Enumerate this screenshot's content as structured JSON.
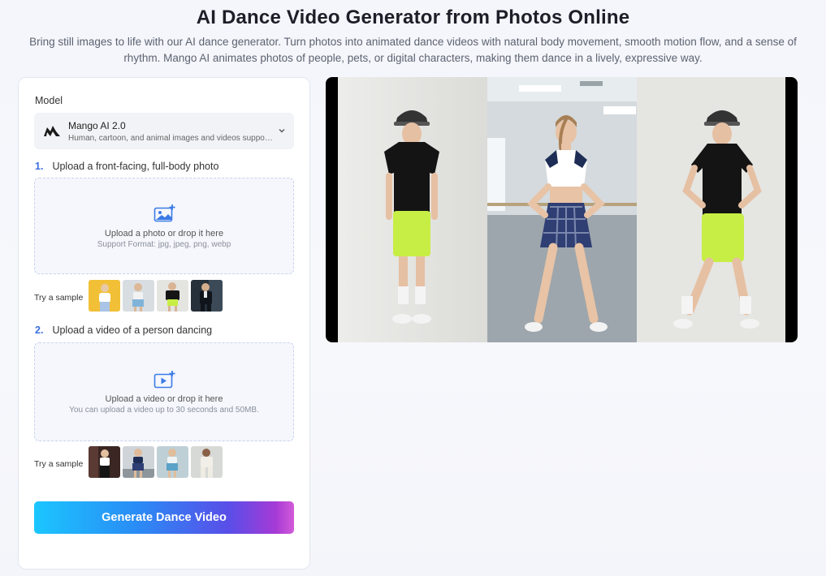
{
  "hero": {
    "title": "AI Dance Video Generator from Photos Online",
    "subtitle": "Bring still images to life with our AI dance generator. Turn photos into animated dance videos with natural body movement, smooth motion flow, and a sense of rhythm. Mango AI animates photos of people, pets, or digital characters, making them dance in a lively, expressive way."
  },
  "panel": {
    "model_label": "Model",
    "model": {
      "name": "Mango AI 2.0",
      "description": "Human, cartoon, and animal images and videos supported",
      "icon": "mango-logo-icon"
    },
    "step1": {
      "number": "1.",
      "label": "Upload a front-facing, full-body photo",
      "drop_title": "Upload a photo or drop it here",
      "drop_hint": "Support Format: jpg, jpeg, png, webp",
      "icon": "image-upload-icon"
    },
    "try_sample": "Try a sample",
    "step2": {
      "number": "2.",
      "label": "Upload a video of a person dancing",
      "drop_title": "Upload a video or drop it here",
      "drop_hint": "You can upload a video up to 30 seconds and 50MB.",
      "icon": "video-upload-icon"
    },
    "generate_label": "Generate Dance Video"
  },
  "colors": {
    "accent": "#3b6fe0",
    "button_gradient_start": "#1bc6ff",
    "button_gradient_end": "#d35bd8",
    "shirt": "#111111",
    "shorts": "#c7ee45"
  }
}
